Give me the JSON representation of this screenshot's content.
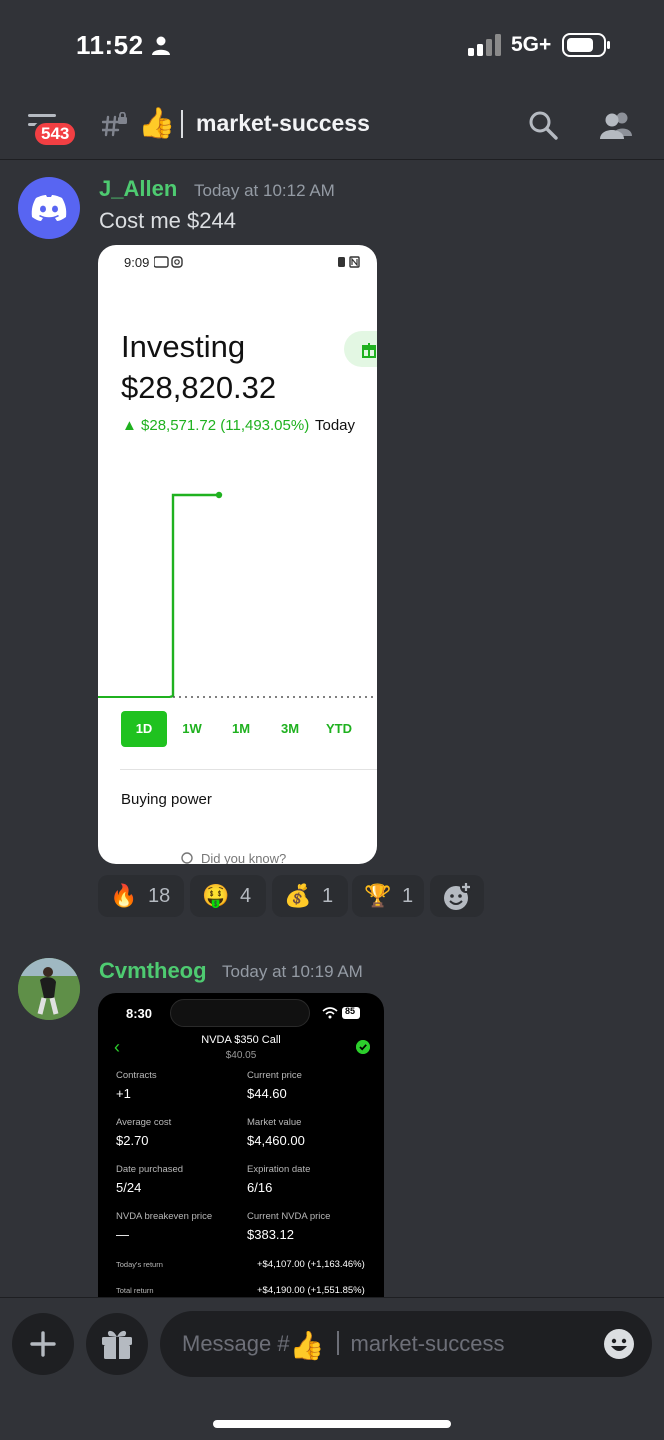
{
  "status_bar": {
    "time": "11:52",
    "network": "5G+"
  },
  "header": {
    "unread_badge": "543",
    "channel_emoji": "👍",
    "channel_name": "market-success"
  },
  "messages": [
    {
      "author": "J_Allen",
      "timestamp": "Today at 10:12 AM",
      "text": "Cost me $244",
      "attachment": {
        "status_time": "9:09",
        "title": "Investing",
        "value": "$28,820.32",
        "change": "▲ $28,571.72 (11,493.05%)",
        "change_period": "Today",
        "range_tabs": [
          "1D",
          "1W",
          "1M",
          "3M",
          "YTD"
        ],
        "active_tab": "1D",
        "buying_power_label": "Buying power",
        "did_you_know": "Did you know?",
        "colors": {
          "accent": "#1fb11f"
        }
      },
      "reactions": [
        {
          "emoji": "🔥",
          "count": "18"
        },
        {
          "emoji": "🤑",
          "count": "4"
        },
        {
          "emoji": "💰",
          "count": "1"
        },
        {
          "emoji": "🏆",
          "count": "1"
        }
      ]
    },
    {
      "author": "Cvmtheog",
      "timestamp": "Today at 10:19 AM",
      "attachment": {
        "status_time": "8:30",
        "battery": "85",
        "title": "NVDA $350 Call",
        "subtitle": "$40.05",
        "fields": [
          {
            "label": "Contracts",
            "value": "+1"
          },
          {
            "label": "Current price",
            "value": "$44.60"
          },
          {
            "label": "Average cost",
            "value": "$2.70"
          },
          {
            "label": "Market value",
            "value": "$4,460.00"
          },
          {
            "label": "Date purchased",
            "value": "5/24"
          },
          {
            "label": "Expiration date",
            "value": "6/16"
          },
          {
            "label": "NVDA breakeven price",
            "value": "—"
          },
          {
            "label": "Current NVDA price",
            "value": "$383.12"
          }
        ],
        "returns": [
          {
            "label": "Today's return",
            "value": "+$4,107.00 (+1,163.46%)"
          },
          {
            "label": "Total return",
            "value": "+$4,190.00 (+1,551.85%)"
          }
        ]
      }
    }
  ],
  "composer": {
    "placeholder_prefix": "Message #",
    "placeholder_emoji": "👍",
    "placeholder_channel": "market-success"
  }
}
